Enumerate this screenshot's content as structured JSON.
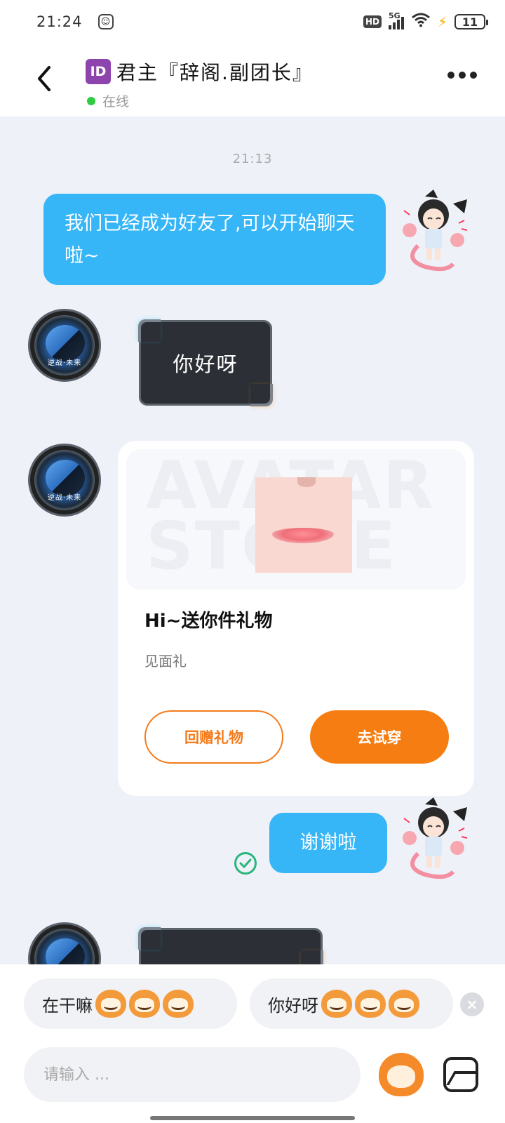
{
  "status_bar": {
    "time": "21:24",
    "network": "5G",
    "hd": "HD",
    "battery": "11"
  },
  "header": {
    "id_badge": "ID",
    "title": "君主『辞阁.副团长』",
    "status": "在线"
  },
  "chat": {
    "timestamp": "21:13",
    "messages": [
      {
        "from": "me",
        "text": "我们已经成为好友了,可以开始聊天啦~"
      },
      {
        "from": "other",
        "text": "你好呀"
      },
      {
        "from": "me",
        "text": "谢谢啦"
      }
    ],
    "avatar_label": "逆战·未来",
    "gift_card": {
      "banner_text": "AVATAR STORE",
      "title": "Hi~送你件礼物",
      "subtitle": "见面礼",
      "return_button": "回赠礼物",
      "try_button": "去试穿"
    }
  },
  "quick_replies": [
    {
      "text": "在干嘛"
    },
    {
      "text": "你好呀"
    }
  ],
  "input": {
    "placeholder": "请输入 ..."
  },
  "colors": {
    "bubble_blue": "#36b5f7",
    "accent_orange": "#f57d12",
    "online_green": "#2ecc40"
  }
}
